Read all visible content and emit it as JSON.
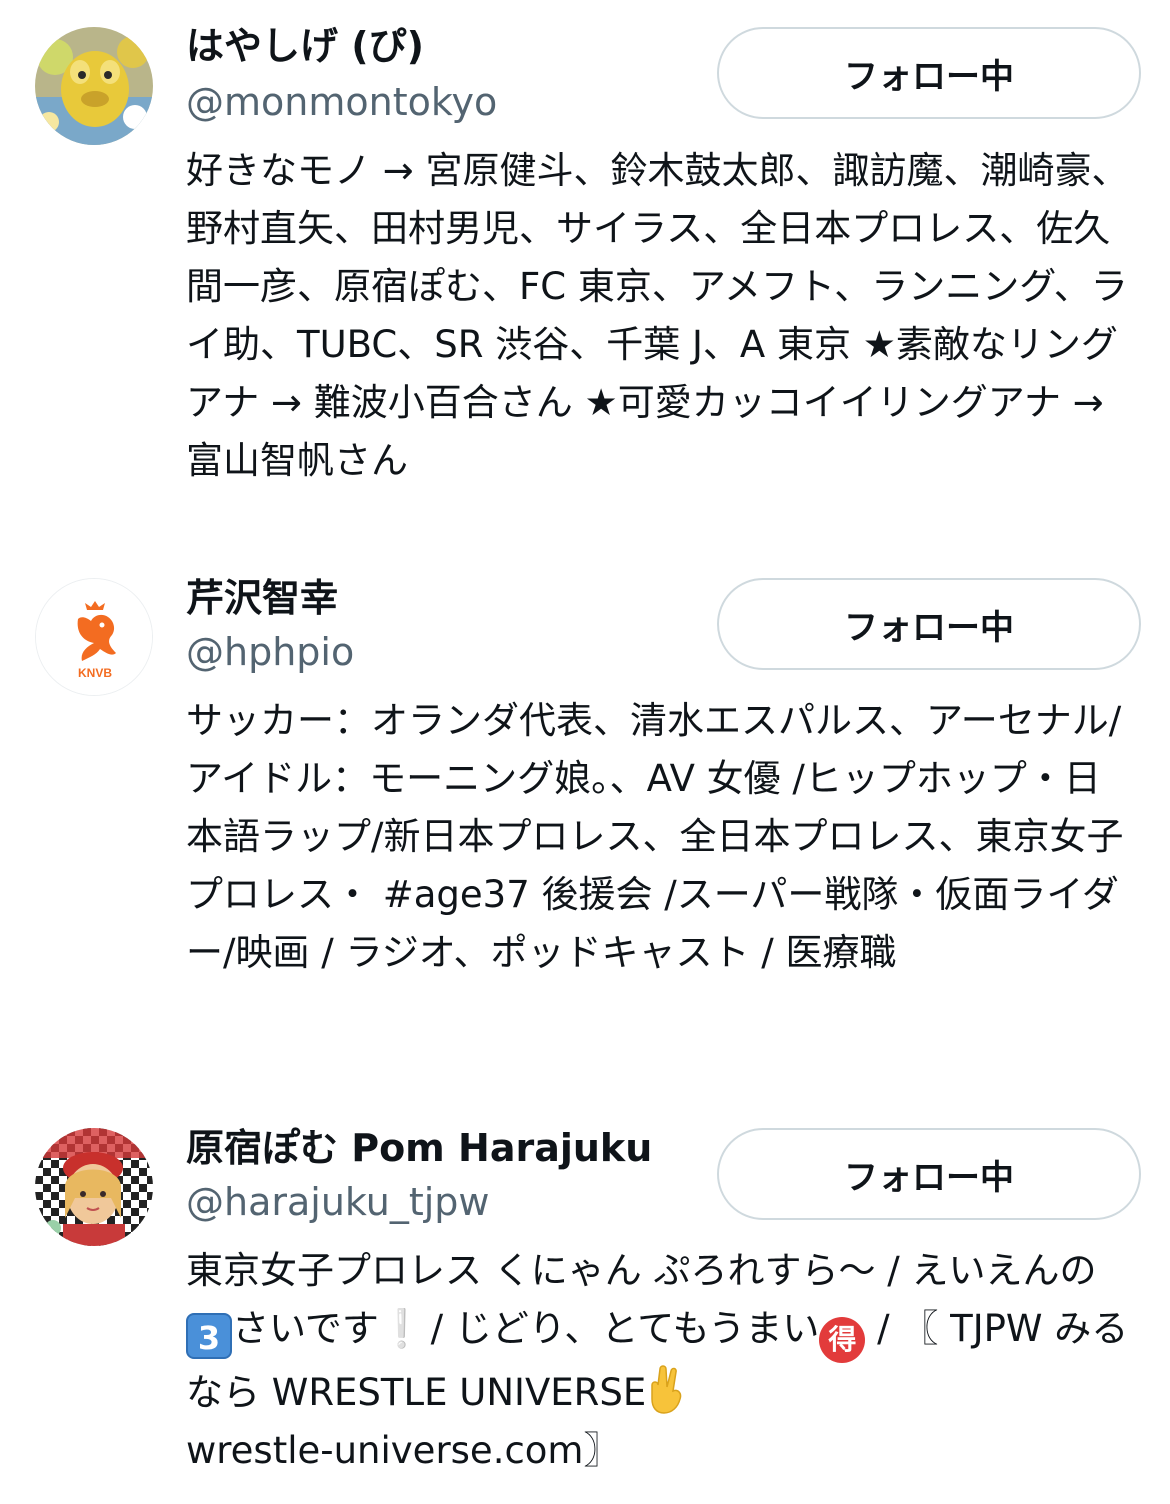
{
  "users": [
    {
      "display_name": "はやしげ (ぴ)",
      "handle": "@monmontokyo",
      "follow_label": "フォロー中",
      "avatar_icon": "plush-toy-avatar-icon",
      "bio": "好きなモノ → 宮原健斗、鈴木鼓太郎、諏訪魔、潮崎豪、野村直矢、田村男児、サイラス、全日本プロレス、佐久間一彦、原宿ぽむ、FC 東京、アメフト、ランニング、ライ助、TUBC、SR 渋谷、千葉 J、A 東京 ★素敵なリングアナ → 難波小百合さん ★可愛カッコイイリングアナ → 富山智帆さん"
    },
    {
      "display_name": "芹沢智幸",
      "handle": "@hphpio",
      "follow_label": "フォロー中",
      "avatar_icon": "knvb-lion-crest-icon",
      "avatar_text": "KNVB",
      "bio": "サッカー：オランダ代表、清水エスパルス、アーセナル/アイドル：モーニング娘。、AV 女優 /ヒップホップ・日本語ラップ/新日本プロレス、全日本プロレス、東京女子プロレス・ #age37 後援会 /スーパー戦隊・仮面ライダー/映画 / ラジオ、ポッドキャスト / 医療職"
    },
    {
      "display_name": "原宿ぽむ Pom Harajuku",
      "handle": "@harajuku_tjpw",
      "follow_label": "フォロー中",
      "avatar_icon": "pom-portrait-avatar-icon",
      "bio_parts": {
        "p1": "東京女子プロレス くにゃん ぷろれすら〜 / えいえんの",
        "e1": "3",
        "p2": "さいです",
        "e2": "❕",
        "p3": " / じどり、とてもうまい",
        "e3": "得",
        "p4": " / 〖 TJPW みるなら WRESTLE UNIVERSE",
        "p5": " wrestle-universe.com〗"
      }
    }
  ],
  "colors": {
    "text_primary": "#0f1419",
    "text_secondary": "#536471",
    "button_border": "#cfd9de"
  }
}
